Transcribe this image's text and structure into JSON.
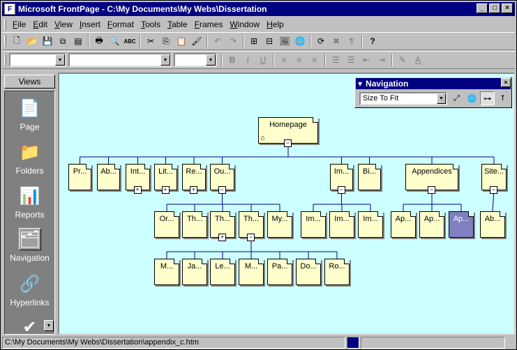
{
  "window": {
    "title": "Microsoft FrontPage - C:\\My Documents\\My Webs\\Dissertation",
    "app_icon": "F"
  },
  "window_buttons": {
    "minimize": "_",
    "maximize": "□",
    "close": "×"
  },
  "menu": [
    {
      "label": "File",
      "underline": "F",
      "rest": "ile"
    },
    {
      "label": "Edit",
      "underline": "E",
      "rest": "dit"
    },
    {
      "label": "View",
      "underline": "V",
      "rest": "iew"
    },
    {
      "label": "Insert",
      "underline": "I",
      "rest": "nsert"
    },
    {
      "label": "Format",
      "underline": "F",
      "rest": "ormat"
    },
    {
      "label": "Tools",
      "underline": "T",
      "rest": "ools"
    },
    {
      "label": "Table",
      "underline": "T",
      "rest": "able"
    },
    {
      "label": "Frames",
      "underline": "F",
      "rest": "rames"
    },
    {
      "label": "Window",
      "underline": "W",
      "rest": "indow"
    },
    {
      "label": "Help",
      "underline": "H",
      "rest": "elp"
    }
  ],
  "toolbar1": {
    "new": "🗋",
    "open": "📂",
    "save": "💾",
    "publish": "⧉",
    "folder_list": "▤",
    "print": "🖶",
    "preview": "🔍",
    "spelling": "ABC",
    "cut": "✂",
    "copy": "⎘",
    "paste": "📋",
    "format_painter": "🖌",
    "undo": "↶",
    "redo": "↷",
    "insert_component": "⊞",
    "insert_table": "⊟",
    "insert_image": "🖼",
    "hyperlink": "🌐",
    "refresh": "⟳",
    "stop": "✖",
    "show_all": "¶",
    "help": "?"
  },
  "toolbar2": {
    "bold": "B",
    "italic": "I",
    "underline": "U",
    "highlight": "✎",
    "font_color": "A"
  },
  "views": {
    "header": "Views",
    "items": [
      {
        "label": "Page",
        "icon": "📄"
      },
      {
        "label": "Folders",
        "icon": "📁"
      },
      {
        "label": "Reports",
        "icon": "📊"
      },
      {
        "label": "Navigation",
        "icon": "🗂"
      },
      {
        "label": "Hyperlinks",
        "icon": "🔗"
      },
      {
        "label": "",
        "icon": "✔"
      }
    ],
    "scroll_down": "▼"
  },
  "navigation_toolbar": {
    "title": "Navigation",
    "zoom_value": "Size To Fit",
    "close": "×",
    "tools": {
      "external": "⤢",
      "web": "🌐",
      "tree": "⊶",
      "up": "⭡"
    }
  },
  "nav_tree": {
    "root": {
      "label": "Homepage"
    },
    "level1": [
      {
        "label": "Pr...",
        "expander": ""
      },
      {
        "label": "Ab...",
        "expander": ""
      },
      {
        "label": "Int...",
        "expander": "+"
      },
      {
        "label": "Lit...",
        "expander": "+"
      },
      {
        "label": "Re...",
        "expander": "+"
      },
      {
        "label": "Ou...",
        "expander": "−"
      },
      {
        "label": "Im...",
        "expander": "−"
      },
      {
        "label": "Bi...",
        "expander": ""
      },
      {
        "label": "Appendices",
        "expander": "−"
      },
      {
        "label": "Site...",
        "expander": "−"
      }
    ],
    "level2": [
      {
        "label": "Or...",
        "expander": ""
      },
      {
        "label": "Th...",
        "expander": ""
      },
      {
        "label": "Th...",
        "expander": "+"
      },
      {
        "label": "Th...",
        "expander": "−"
      },
      {
        "label": "My...",
        "expander": ""
      },
      {
        "label": "Im...",
        "expander": ""
      },
      {
        "label": "Im...",
        "expander": ""
      },
      {
        "label": "Im...",
        "expander": ""
      },
      {
        "label": "Ap...",
        "expander": ""
      },
      {
        "label": "Ap...",
        "expander": ""
      },
      {
        "label": "Ap...",
        "expander": "",
        "selected": true
      },
      {
        "label": "Ab...",
        "expander": ""
      }
    ],
    "level3": [
      {
        "label": "M..."
      },
      {
        "label": "Ja..."
      },
      {
        "label": "Le..."
      },
      {
        "label": "M..."
      },
      {
        "label": "Pa..."
      },
      {
        "label": "Do..."
      },
      {
        "label": "Ro..."
      }
    ],
    "home_icon": "⌂"
  },
  "status": {
    "text": "C:\\My Documents\\My Webs\\Dissertation\\appendix_c.htm"
  },
  "colors": {
    "title_bar": "#000080",
    "canvas": "#ccffff",
    "node": "#ffffcc",
    "node_selected": "#8080c0"
  }
}
